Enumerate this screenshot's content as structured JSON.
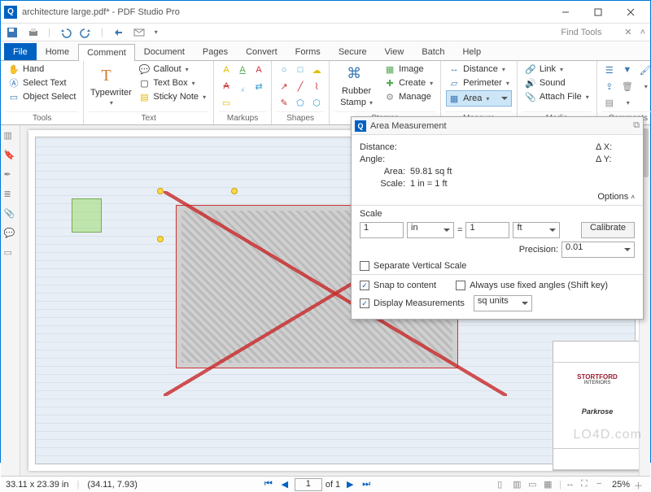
{
  "window": {
    "title": "architecture large.pdf* - PDF Studio Pro"
  },
  "qat": {
    "find_tools": "Find Tools"
  },
  "tabs": {
    "file": "File",
    "home": "Home",
    "comment": "Comment",
    "document": "Document",
    "pages": "Pages",
    "convert": "Convert",
    "forms": "Forms",
    "secure": "Secure",
    "view": "View",
    "batch": "Batch",
    "help": "Help"
  },
  "ribbon": {
    "tools": {
      "label": "Tools",
      "hand": "Hand",
      "select_text": "Select Text",
      "object_select": "Object Select"
    },
    "text": {
      "label": "Text",
      "typewriter": "Typewriter",
      "callout": "Callout",
      "text_box": "Text Box",
      "sticky": "Sticky Note"
    },
    "markups": {
      "label": "Markups"
    },
    "shapes": {
      "label": "Shapes"
    },
    "stamps": {
      "label": "Stamps",
      "rubber": "Rubber",
      "stamp": "Stamp",
      "image": "Image",
      "create": "Create",
      "manage": "Manage"
    },
    "measure": {
      "label": "Measure",
      "distance": "Distance",
      "perimeter": "Perimeter",
      "area": "Area"
    },
    "media": {
      "label": "Media",
      "link": "Link",
      "sound": "Sound",
      "attach": "Attach File"
    },
    "comments": {
      "label": "Comments"
    }
  },
  "panel": {
    "title": "Area Measurement",
    "distance_lab": "Distance:",
    "angle_lab": "Angle:",
    "area_lab": "Area:",
    "area_val": "59.81 sq ft",
    "scale_lab": "Scale:",
    "scale_val": "1 in = 1 ft",
    "dx": "Δ X:",
    "dy": "Δ Y:",
    "options": "Options",
    "scale_hdr": "Scale",
    "scale_from_val": "1",
    "scale_from_unit": "in",
    "eq": "=",
    "scale_to_val": "1",
    "scale_to_unit": "ft",
    "calibrate": "Calibrate",
    "precision_lab": "Precision:",
    "precision_val": "0.01",
    "sep_vert": "Separate Vertical Scale",
    "snap": "Snap to content",
    "fixed_angles": "Always use fixed angles (Shift key)",
    "display_meas": "Display Measurements",
    "units": "sq units"
  },
  "legend": {
    "brand1": "STORTFORD",
    "brand1b": "INTERIORS",
    "brand2": "Parkrose"
  },
  "status": {
    "dims": "33.11 x 23.39 in",
    "coords": "(34.11, 7.93)",
    "page": "1",
    "of": "of 1",
    "zoom": "25%"
  },
  "watermark": "LO4D.com"
}
